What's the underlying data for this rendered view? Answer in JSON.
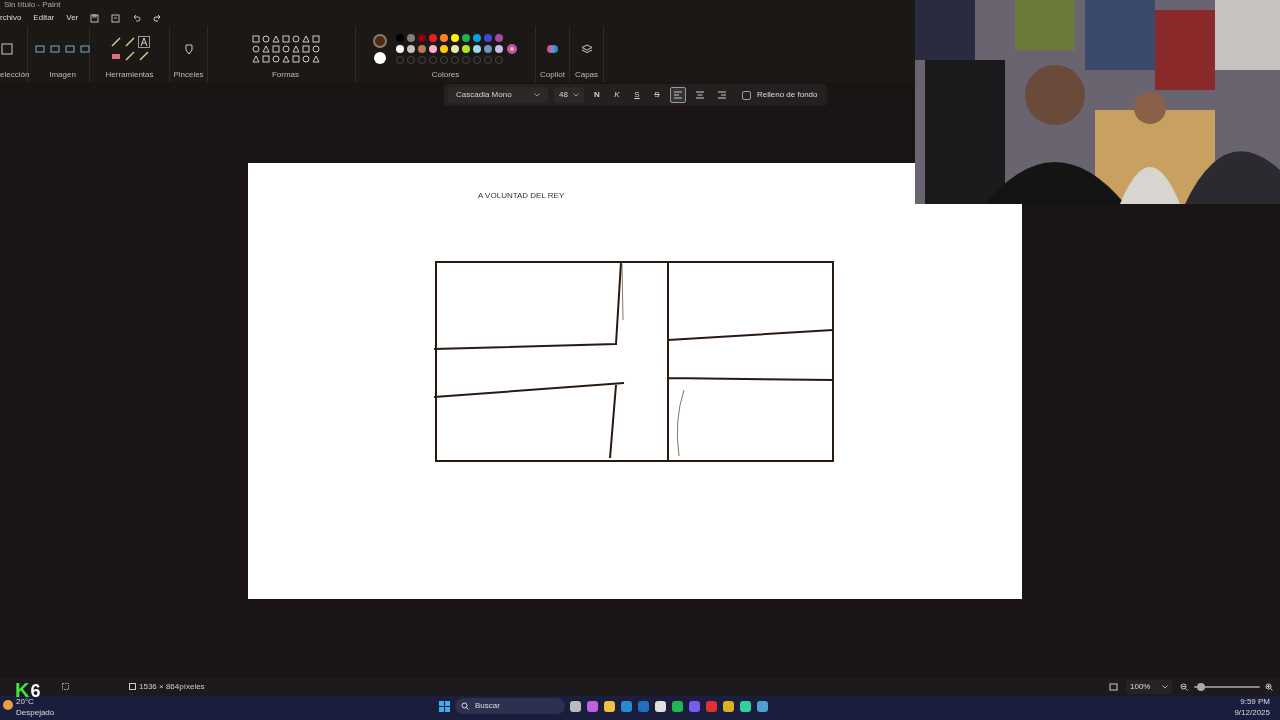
{
  "window": {
    "title": "Sin título - Paint"
  },
  "menu": [
    "rchivo",
    "Editar",
    "Ver"
  ],
  "ribbon_groups": [
    {
      "label": "elección"
    },
    {
      "label": "Imagen"
    },
    {
      "label": "Herramientas"
    },
    {
      "label": "Pinceles"
    },
    {
      "label": "Formas"
    },
    {
      "label": "Colores"
    },
    {
      "label": "Copilot"
    },
    {
      "label": "Capas"
    }
  ],
  "colors": {
    "current": [
      {
        "color": "#4a2a10"
      },
      {
        "color": "#ffffff"
      }
    ],
    "palette": [
      {
        "color": "#000000"
      },
      {
        "color": "#7f7f7f"
      },
      {
        "color": "#880015"
      },
      {
        "color": "#ed1c24"
      },
      {
        "color": "#ff7f27"
      },
      {
        "color": "#fff200"
      },
      {
        "color": "#22b14c"
      },
      {
        "color": "#00a2e8"
      },
      {
        "color": "#3f48cc"
      },
      {
        "color": "#a349a4"
      },
      {
        "color": "#ffffff"
      },
      {
        "color": "#c3c3c3"
      },
      {
        "color": "#b97a57"
      },
      {
        "color": "#ffaec9"
      },
      {
        "color": "#ffc90e"
      },
      {
        "color": "#efe4b0"
      },
      {
        "color": "#b5e61d"
      },
      {
        "color": "#99d9ea"
      },
      {
        "color": "#7092be"
      },
      {
        "color": "#c8bfe7"
      }
    ]
  },
  "text_toolbar": {
    "font": "Cascadia Mono",
    "size": "48",
    "styles": [
      {
        "label": "N",
        "kind": "bold",
        "selected": false
      },
      {
        "label": "K",
        "kind": "italic",
        "selected": false
      },
      {
        "label": "S",
        "kind": "underline",
        "selected": false
      },
      {
        "label": "S",
        "kind": "strike",
        "selected": false
      }
    ],
    "alignment": [
      {
        "kind": "left",
        "selected": true
      },
      {
        "kind": "center",
        "selected": false
      },
      {
        "kind": "right",
        "selected": false
      }
    ],
    "background_fill": {
      "label": "Relleno de fondo",
      "checked": false
    }
  },
  "canvas": {
    "text": "A VOLUNTAD DEL REY"
  },
  "webcam": {
    "kind": "picture"
  },
  "stream_logo": [
    "K",
    "6"
  ],
  "status_bar": {
    "canvas_size": "1536 × 864píxeles",
    "zoom": "100%",
    "level": 0.1
  },
  "taskbar": {
    "weather": {
      "temp": "20°C",
      "condition": "Despejado"
    },
    "search": "Buscar",
    "time": "9:59 PM",
    "date": "9/12/2025"
  }
}
